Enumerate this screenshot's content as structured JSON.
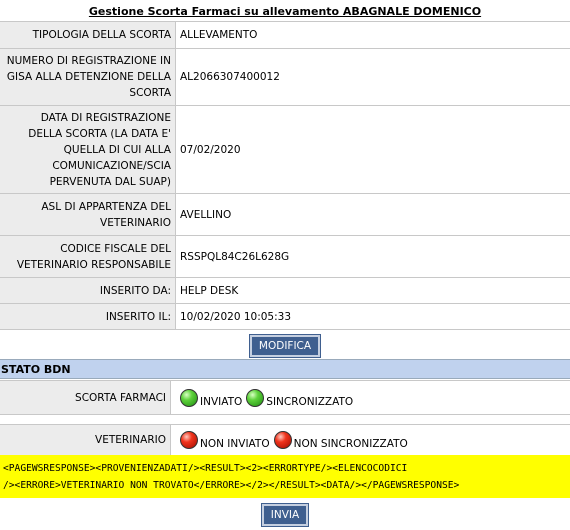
{
  "title": "Gestione Scorta Farmaci su allevamento ABAGNALE DOMENICO",
  "rows": [
    {
      "label": "TIPOLOGIA DELLA SCORTA",
      "value": "ALLEVAMENTO"
    },
    {
      "label": "NUMERO DI REGISTRAZIONE IN GISA ALLA DETENZIONE DELLA SCORTA",
      "value": "AL2066307400012"
    },
    {
      "label": "DATA DI REGISTRAZIONE DELLA SCORTA (LA DATA E' QUELLA DI CUI ALLA COMUNICAZIONE/SCIA PERVENUTA DAL SUAP)",
      "value": "07/02/2020"
    },
    {
      "label": "ASL DI APPARTENZA DEL VETERINARIO",
      "value": "AVELLINO"
    },
    {
      "label": "CODICE FISCALE DEL VETERINARIO RESPONSABILE",
      "value": "RSSPQL84C26L628G"
    },
    {
      "label": "INSERITO DA:",
      "value": "HELP DESK"
    },
    {
      "label": "INSERITO IL:",
      "value": "10/02/2020 10:05:33"
    }
  ],
  "buttons": {
    "modifica": "MODIFICA",
    "invia": "INVIA"
  },
  "stato": {
    "title": "STATO BDN",
    "rows": [
      {
        "label": "SCORTA FARMACI",
        "statuses": [
          {
            "color": "green",
            "text": "INVIATO"
          },
          {
            "color": "green",
            "text": "SINCRONIZZATO"
          }
        ]
      },
      {
        "label": "VETERINARIO",
        "statuses": [
          {
            "color": "red",
            "text": "NON INVIATO"
          },
          {
            "color": "red",
            "text": "NON SINCRONIZZATO"
          }
        ]
      }
    ]
  },
  "response": {
    "line1": "<PAGEWSRESPONSE><PROVENIENZADATI/><RESULT><2><ERRORTYPE/><ELENCOCODICI",
    "line2": "/><ERRORE>VETERINARIO NON TROVATO</ERRORE></2></RESULT><DATA/></PAGEWSRESPONSE>"
  },
  "colors": {
    "section_bar": "#c0d2ee",
    "button": "#3f5f8f",
    "response_bg": "#ffff00",
    "label_bg": "#ececec"
  }
}
